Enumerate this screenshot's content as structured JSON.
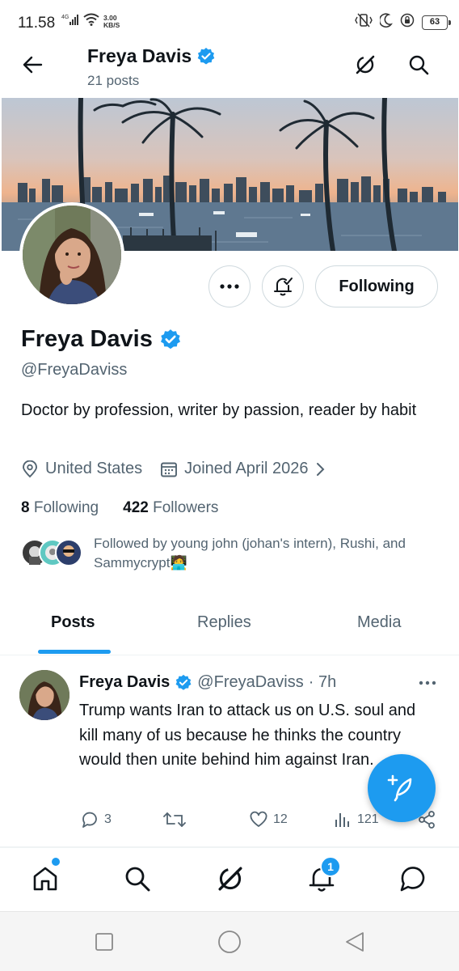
{
  "status_bar": {
    "time": "11.58",
    "network": "4G",
    "speed_value": "3.00",
    "speed_unit": "KB/S",
    "battery": "63"
  },
  "topbar": {
    "name": "Freya Davis",
    "posts_count": "21 posts",
    "icons": [
      "back-arrow-icon",
      "grok-icon",
      "search-icon"
    ]
  },
  "profile": {
    "name": "Freya Davis",
    "handle": "@FreyaDaviss",
    "bio": "Doctor by profession, writer by passion, reader by habit",
    "location": "United States",
    "joined": "Joined April 2026",
    "following_count": "8",
    "following_label": "Following",
    "followers_count": "422",
    "followers_label": "Followers",
    "followed_by": "Followed by young john (johan's intern), Rushi, and Sammycrypt🧑‍💻"
  },
  "actions": {
    "follow_button": "Following"
  },
  "tabs": [
    {
      "label": "Posts",
      "active": true
    },
    {
      "label": "Replies",
      "active": false
    },
    {
      "label": "Media",
      "active": false
    }
  ],
  "post": {
    "name": "Freya Davis",
    "handle": "@FreyaDaviss",
    "time": "· 7h",
    "text": "Trump wants Iran to attack us on U.S. soul and kill many of us because he thinks the country would then unite behind him against Iran.",
    "replies": "3",
    "reposts": "",
    "likes": "12",
    "views": "121"
  },
  "bottom_nav": {
    "notification_badge": "1",
    "items": [
      "home-icon",
      "search-icon",
      "grok-icon",
      "bell-icon",
      "messages-icon"
    ]
  },
  "colors": {
    "accent": "#1d9bf0",
    "text": "#0f1419",
    "secondary": "#536471"
  }
}
